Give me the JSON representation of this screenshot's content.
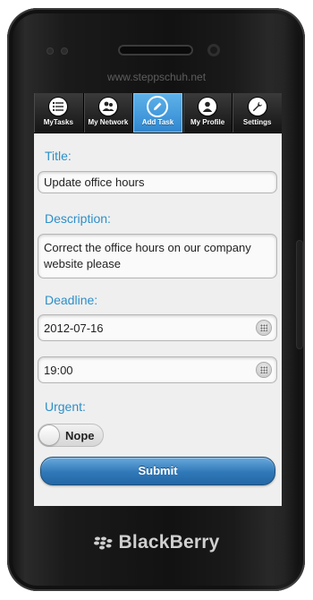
{
  "watermark": "www.steppschuh.net",
  "nav": {
    "tabs": [
      {
        "label": "MyTasks",
        "icon": "task-list-icon",
        "active": false
      },
      {
        "label": "My Network",
        "icon": "network-icon",
        "active": false
      },
      {
        "label": "Add Task",
        "icon": "pencil-icon",
        "active": true
      },
      {
        "label": "My Profile",
        "icon": "profile-icon",
        "active": false
      },
      {
        "label": "Settings",
        "icon": "wrench-icon",
        "active": false
      }
    ]
  },
  "form": {
    "title_label": "Title:",
    "title_value": "Update office hours",
    "description_label": "Description:",
    "description_value": "Correct the office hours on our company website please",
    "deadline_label": "Deadline:",
    "date_value": "2012-07-16",
    "time_value": "19:00",
    "urgent_label": "Urgent:",
    "urgent_value": "Nope",
    "submit_label": "Submit"
  },
  "device": {
    "brand": "BlackBerry"
  },
  "colors": {
    "accent": "#2d8fc9",
    "active_tab": "#3a91d6",
    "button": "#2f78b8"
  }
}
